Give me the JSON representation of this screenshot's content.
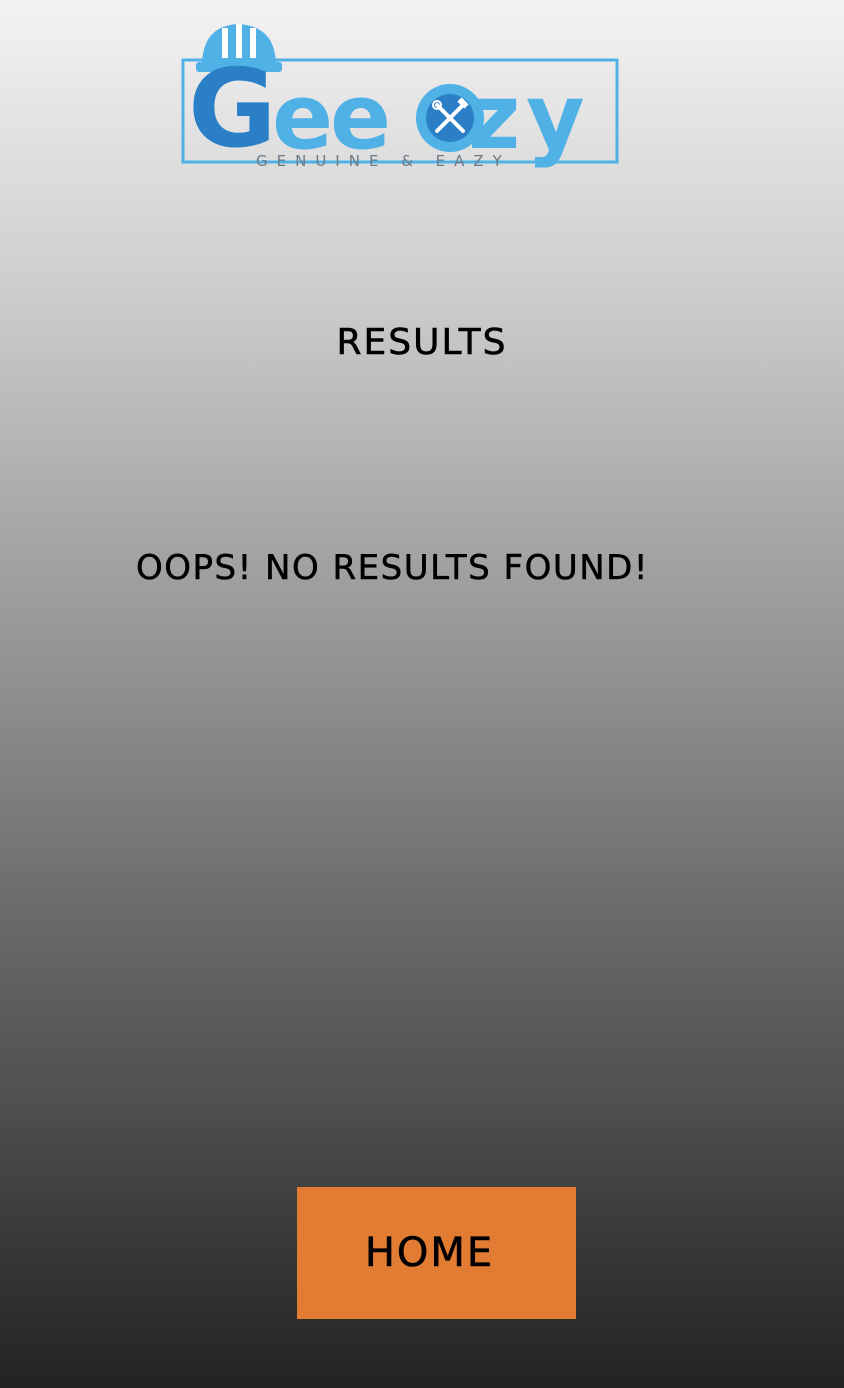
{
  "brand": {
    "logo_wordmark": "Geeazy",
    "logo_tagline": "GENUINE & EAZY",
    "icon": "hardhat-tools-logo",
    "colors": {
      "dark_blue": "#2a7fc6",
      "light_blue": "#4fb1e6",
      "tagline_gray": "#6c7a86"
    }
  },
  "results": {
    "heading": "RESULTS",
    "empty_message": "OOPS! NO RESULTS FOUND!"
  },
  "actions": {
    "home_label": "HOME",
    "home_color": "#e27c32"
  }
}
